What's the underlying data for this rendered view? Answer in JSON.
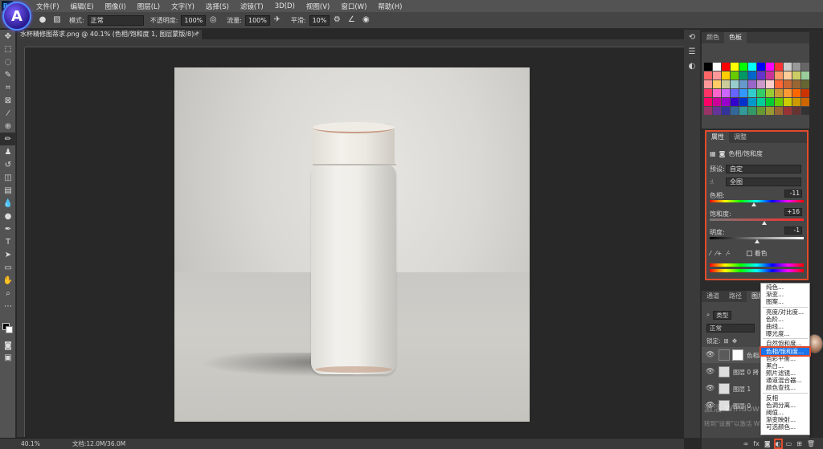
{
  "menubar": {
    "items": [
      "文件(F)",
      "编辑(E)",
      "图像(I)",
      "图层(L)",
      "文字(Y)",
      "选择(S)",
      "滤镜(T)",
      "3D(D)",
      "视图(V)",
      "窗口(W)",
      "帮助(H)"
    ]
  },
  "options": {
    "mode_label": "模式:",
    "mode_value": "正常",
    "opacity_label": "不透明度:",
    "opacity_value": "100%",
    "flow_label": "流量:",
    "flow_value": "100%",
    "smooth_label": "平滑:",
    "smooth_value": "10%"
  },
  "document": {
    "tab_title": "水杯精修图蒂求.png @ 40.1% (色相/饱和度 1, 图层蒙版/8) *"
  },
  "swatches_panel": {
    "tabs": [
      "颜色",
      "色板"
    ],
    "colors": [
      "#000000",
      "#ffffff",
      "#ff0000",
      "#ffff00",
      "#00ff00",
      "#00ffff",
      "#0000ff",
      "#ff00ff",
      "#ff3333",
      "#cccccc",
      "#999999",
      "#666666",
      "#ff6666",
      "#ff9999",
      "#ffcc00",
      "#66cc00",
      "#009966",
      "#0066cc",
      "#6633cc",
      "#cc3399",
      "#ff9966",
      "#ffcc99",
      "#cccc66",
      "#99cc99",
      "#ff9999",
      "#ffcc66",
      "#cccc99",
      "#99cccc",
      "#6699cc",
      "#9966cc",
      "#cc99cc",
      "#ffcccc",
      "#ff6633",
      "#cc6633",
      "#996633",
      "#666633",
      "#ff3366",
      "#ff66cc",
      "#cc66ff",
      "#6666ff",
      "#3399ff",
      "#33cccc",
      "#33cc66",
      "#99cc33",
      "#cc9933",
      "#ff9933",
      "#ff6600",
      "#cc3300",
      "#ff0066",
      "#cc0099",
      "#9900cc",
      "#3300cc",
      "#0033cc",
      "#0099cc",
      "#00cc99",
      "#00cc33",
      "#66cc00",
      "#cccc00",
      "#cc9900",
      "#cc6600",
      "#993366",
      "#663399",
      "#333399",
      "#336699",
      "#339999",
      "#339966",
      "#669933",
      "#999933",
      "#996633",
      "#993333",
      "#663333",
      "#333333"
    ]
  },
  "properties_panel": {
    "tabs": [
      "属性",
      "调整"
    ],
    "type_label": "色相/饱和度",
    "preset_label": "预设:",
    "preset_value": "自定",
    "channel_value": "全图",
    "hue_label": "色相:",
    "hue_value": "-11",
    "saturation_label": "饱和度:",
    "saturation_value": "+16",
    "lightness_label": "明度:",
    "lightness_value": "-1",
    "colorize_label": "着色",
    "hue_position": 0.47,
    "saturation_position": 0.58,
    "lightness_position": 0.5
  },
  "layers_panel": {
    "tabs": [
      "通道",
      "路径",
      "图层"
    ],
    "filter_label": "类型",
    "blend_mode": "正常",
    "lock_label": "锁定:",
    "layers": [
      {
        "name": "色相/饱和度 1"
      },
      {
        "name": "图层 0 拷"
      },
      {
        "name": "图层 1"
      },
      {
        "name": "图层 0"
      }
    ]
  },
  "context_menu": {
    "group1": [
      "纯色...",
      "渐变...",
      "图案..."
    ],
    "group2": [
      "亮度/对比度...",
      "色阶...",
      "曲线...",
      "曝光度..."
    ],
    "group3": [
      "自然饱和度...",
      "色相/饱和度...",
      "色彩平衡...",
      "黑白...",
      "照片滤镜...",
      "通道混合器...",
      "颜色查找..."
    ],
    "group4": [
      "反相",
      "色调分离...",
      "阈值...",
      "渐变映射...",
      "可选颜色..."
    ],
    "selected": "色相/饱和度..."
  },
  "status": {
    "zoom": "40.1%",
    "doc_size": "文档:12.0M/36.0M"
  },
  "watermark": {
    "line1": "激活 Windows",
    "line2": "转到\"设置\"以激活 Windows。"
  }
}
